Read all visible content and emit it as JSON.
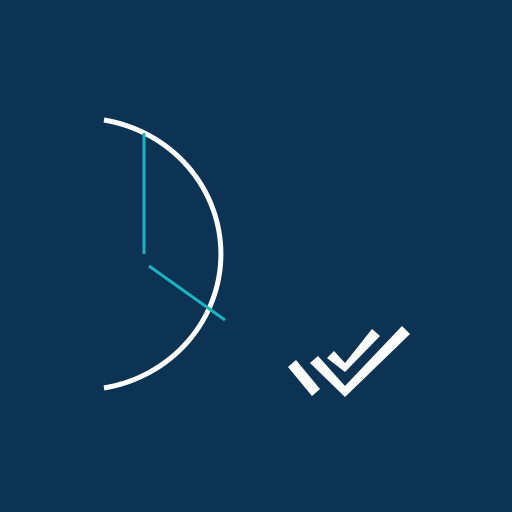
{
  "app_icon": {
    "name": "clock-checkmark-logo",
    "colors": {
      "background": "#0d3354",
      "clock_outline": "#ffffff",
      "clock_hands": "#1bb3bf",
      "checkmarks": "#ffffff"
    }
  }
}
